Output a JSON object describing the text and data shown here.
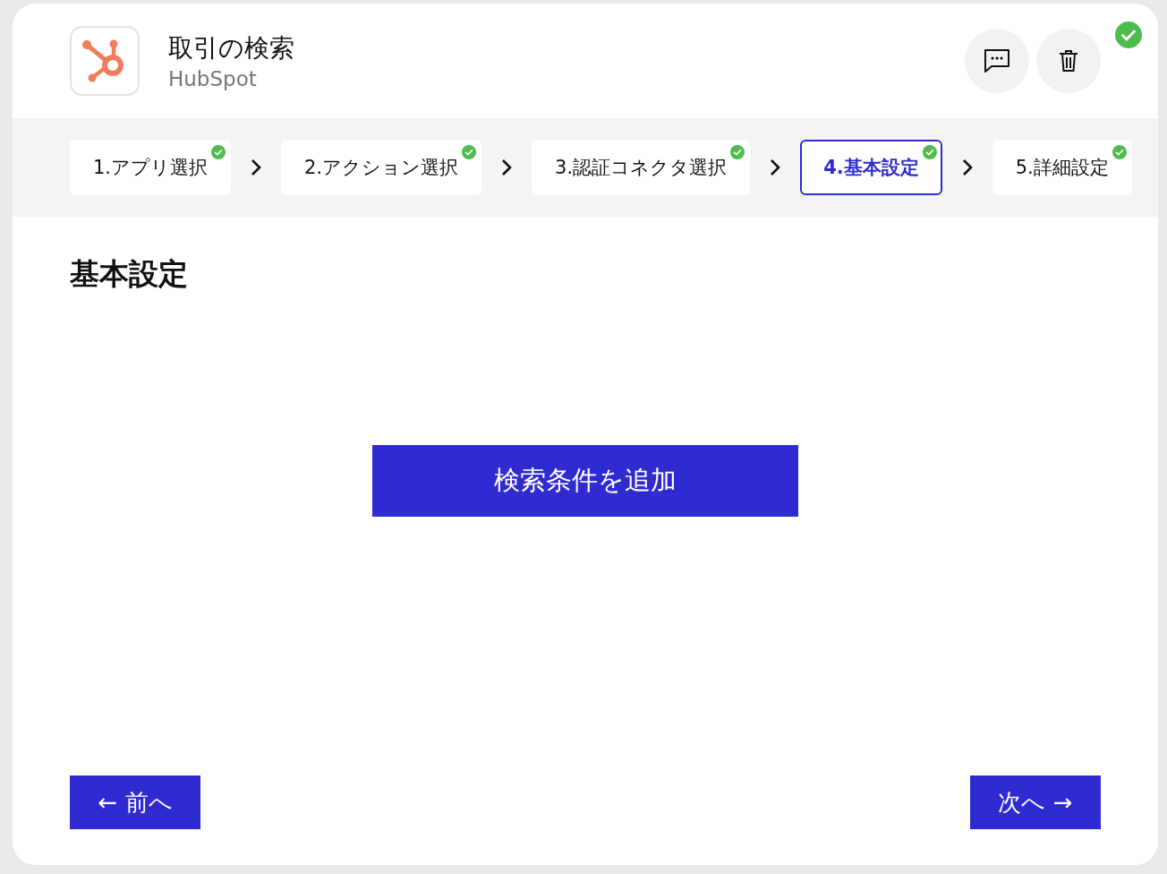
{
  "header": {
    "title": "取引の検索",
    "subtitle": "HubSpot",
    "complete": true
  },
  "steps": [
    {
      "label": "1.アプリ選択",
      "selected": false,
      "done": true
    },
    {
      "label": "2.アクション選択",
      "selected": false,
      "done": true
    },
    {
      "label": "3.認証コネクタ選択",
      "selected": false,
      "done": true
    },
    {
      "label": "4.基本設定",
      "selected": true,
      "done": true
    },
    {
      "label": "5.詳細設定",
      "selected": false,
      "done": true
    }
  ],
  "section": {
    "heading": "基本設定",
    "add_button": "検索条件を追加"
  },
  "nav": {
    "prev": "← 前へ",
    "next": "次へ →"
  }
}
